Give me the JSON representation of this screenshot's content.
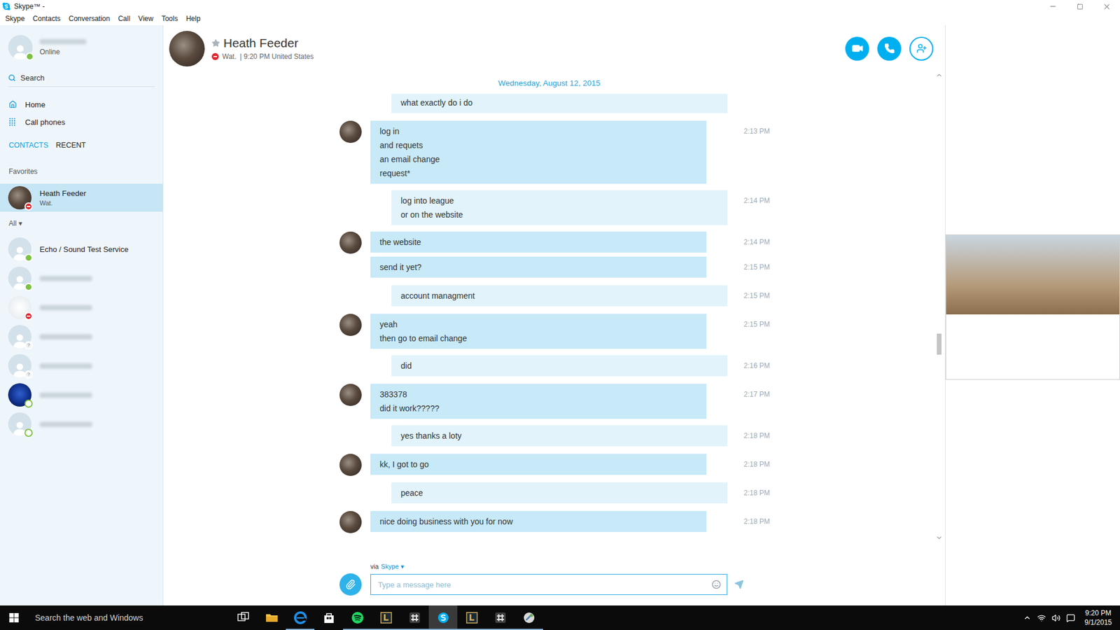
{
  "window": {
    "title": "Skype™ - "
  },
  "menu": [
    "Skype",
    "Contacts",
    "Conversation",
    "Call",
    "View",
    "Tools",
    "Help"
  ],
  "profile": {
    "redacted": true,
    "status": "Online",
    "presence": "online"
  },
  "nav": {
    "search": "Search",
    "items": [
      {
        "label": "Home",
        "kind": "home"
      },
      {
        "label": "Call phones",
        "kind": "dialpad"
      }
    ]
  },
  "tabs": [
    {
      "label": "CONTACTS",
      "selected": true
    },
    {
      "label": "RECENT",
      "selected": false
    }
  ],
  "favorites": {
    "label": "Favorites",
    "contacts": [
      {
        "name": "Heath Feeder",
        "mood": "Wat.",
        "presence": "busy",
        "badge": "",
        "photo": "brown",
        "redacted": false,
        "selected": true
      }
    ]
  },
  "all": {
    "label": "All ▾",
    "contacts": [
      {
        "name": "Echo / Sound Test Service",
        "mood": "",
        "presence": "online",
        "badge": "",
        "photo": "none",
        "redacted": false,
        "selected": false
      },
      {
        "name": "",
        "mood": "",
        "presence": "online",
        "badge": "",
        "photo": "none",
        "redacted": true,
        "selected": false
      },
      {
        "name": "",
        "mood": "",
        "presence": "busy",
        "badge": "",
        "photo": "light",
        "redacted": true,
        "selected": false
      },
      {
        "name": "",
        "mood": "",
        "presence": "unknown",
        "badge": "?",
        "photo": "none",
        "redacted": true,
        "selected": false
      },
      {
        "name": "",
        "mood": "",
        "presence": "unknown",
        "badge": "?",
        "photo": "none",
        "redacted": true,
        "selected": false
      },
      {
        "name": "",
        "mood": "",
        "presence": "ring",
        "badge": "",
        "photo": "blue",
        "redacted": true,
        "selected": false
      },
      {
        "name": "",
        "mood": "",
        "presence": "ring",
        "badge": "",
        "photo": "none",
        "redacted": true,
        "selected": false
      }
    ]
  },
  "header": {
    "name": "Heath Feeder",
    "mood": "Wat.",
    "local_time": "| 9:20 PM United States",
    "presence": "busy"
  },
  "conversation": {
    "date": "Wednesday, August 12, 2015",
    "messages": [
      {
        "from": "me",
        "avatar": false,
        "lines": [
          "what exactly do i do"
        ],
        "time": ""
      },
      {
        "from": "them",
        "avatar": true,
        "lines": [
          "log in",
          "and requets",
          "an email change",
          "request*"
        ],
        "time": "2:13 PM"
      },
      {
        "from": "me",
        "avatar": false,
        "lines": [
          "log into league",
          "or on the website"
        ],
        "time": "2:14 PM"
      },
      {
        "from": "them",
        "avatar": true,
        "lines": [
          "the website"
        ],
        "time": "2:14 PM"
      },
      {
        "from": "them",
        "avatar": false,
        "lines": [
          "send it yet?"
        ],
        "time": "2:15 PM"
      },
      {
        "from": "me",
        "avatar": false,
        "lines": [
          "account managment"
        ],
        "time": "2:15 PM"
      },
      {
        "from": "them",
        "avatar": true,
        "lines": [
          "yeah",
          "then go to email change"
        ],
        "time": "2:15 PM"
      },
      {
        "from": "me",
        "avatar": false,
        "lines": [
          "did"
        ],
        "time": "2:16 PM"
      },
      {
        "from": "them",
        "avatar": true,
        "lines": [
          "383378",
          "did it work?????"
        ],
        "time": "2:17 PM"
      },
      {
        "from": "me",
        "avatar": false,
        "lines": [
          "yes thanks a loty"
        ],
        "time": "2:18 PM"
      },
      {
        "from": "them",
        "avatar": true,
        "lines": [
          "kk, I got to go"
        ],
        "time": "2:18 PM"
      },
      {
        "from": "me",
        "avatar": false,
        "lines": [
          "peace"
        ],
        "time": "2:18 PM"
      },
      {
        "from": "them",
        "avatar": true,
        "lines": [
          "nice doing business with you for now"
        ],
        "time": "2:18 PM"
      }
    ]
  },
  "scrollbar": {
    "position": 0.56
  },
  "composer": {
    "via": "via",
    "service": "Skype ▾",
    "placeholder": "Type a message here"
  },
  "taskbar": {
    "search": "Search the web and Windows",
    "apps": [
      {
        "kind": "taskview",
        "open": false,
        "active": false
      },
      {
        "kind": "explorer",
        "open": false,
        "active": false
      },
      {
        "kind": "edge",
        "open": true,
        "active": false
      },
      {
        "kind": "store",
        "open": false,
        "active": false
      },
      {
        "kind": "spotify",
        "open": true,
        "active": false
      },
      {
        "kind": "league",
        "open": true,
        "active": false
      },
      {
        "kind": "slack",
        "open": true,
        "active": false
      },
      {
        "kind": "skype",
        "open": true,
        "active": true
      },
      {
        "kind": "league",
        "open": true,
        "active": false
      },
      {
        "kind": "slack",
        "open": true,
        "active": false
      },
      {
        "kind": "tool",
        "open": true,
        "active": false
      }
    ],
    "time": "9:20 PM",
    "date": "9/1/2015"
  }
}
